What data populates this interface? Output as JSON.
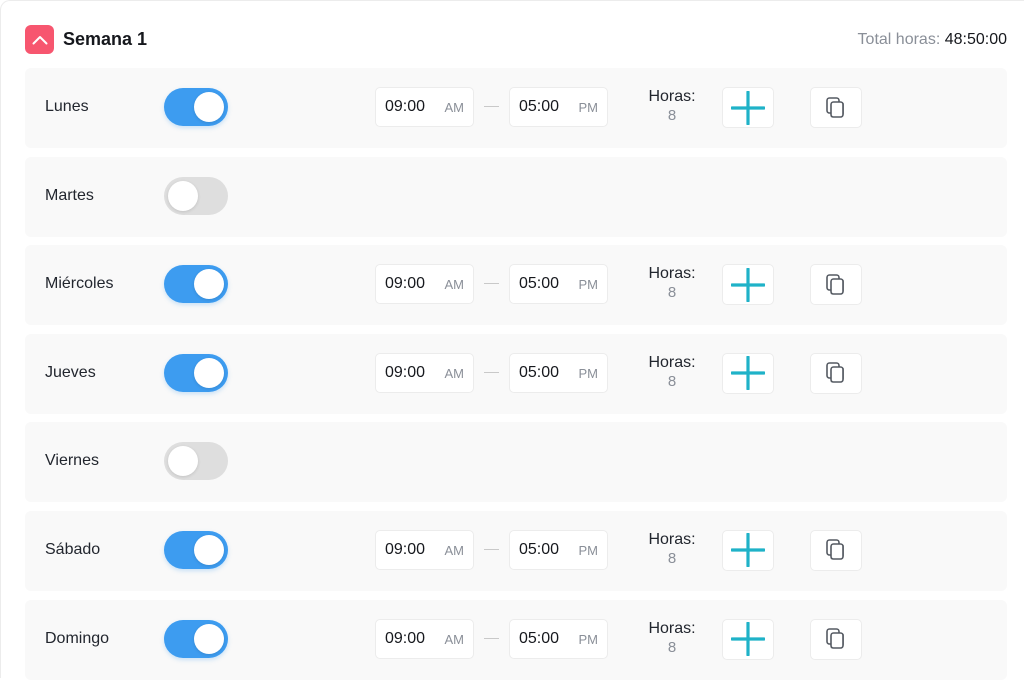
{
  "header": {
    "title": "Semana 1",
    "total_label": "Total horas:",
    "total_value": "48:50:00"
  },
  "colors": {
    "accent": "#f7566f",
    "toggle_on": "#3d9cf0",
    "toggle_off": "#dedede",
    "plus": "#1fb2c8"
  },
  "days": [
    {
      "name": "Lunes",
      "enabled": true,
      "start": "09:00",
      "start_period": "AM",
      "end": "05:00",
      "end_period": "PM",
      "hours_label": "Horas:",
      "hours": "8"
    },
    {
      "name": "Martes",
      "enabled": false
    },
    {
      "name": "Miércoles",
      "enabled": true,
      "start": "09:00",
      "start_period": "AM",
      "end": "05:00",
      "end_period": "PM",
      "hours_label": "Horas:",
      "hours": "8"
    },
    {
      "name": "Jueves",
      "enabled": true,
      "start": "09:00",
      "start_period": "AM",
      "end": "05:00",
      "end_period": "PM",
      "hours_label": "Horas:",
      "hours": "8"
    },
    {
      "name": "Viernes",
      "enabled": false
    },
    {
      "name": "Sábado",
      "enabled": true,
      "start": "09:00",
      "start_period": "AM",
      "end": "05:00",
      "end_period": "PM",
      "hours_label": "Horas:",
      "hours": "8"
    },
    {
      "name": "Domingo",
      "enabled": true,
      "start": "09:00",
      "start_period": "AM",
      "end": "05:00",
      "end_period": "PM",
      "hours_label": "Horas:",
      "hours": "8"
    }
  ],
  "icons": {
    "collapse": "chevron-up-icon",
    "add": "plus-icon",
    "copy": "copy-icon"
  }
}
